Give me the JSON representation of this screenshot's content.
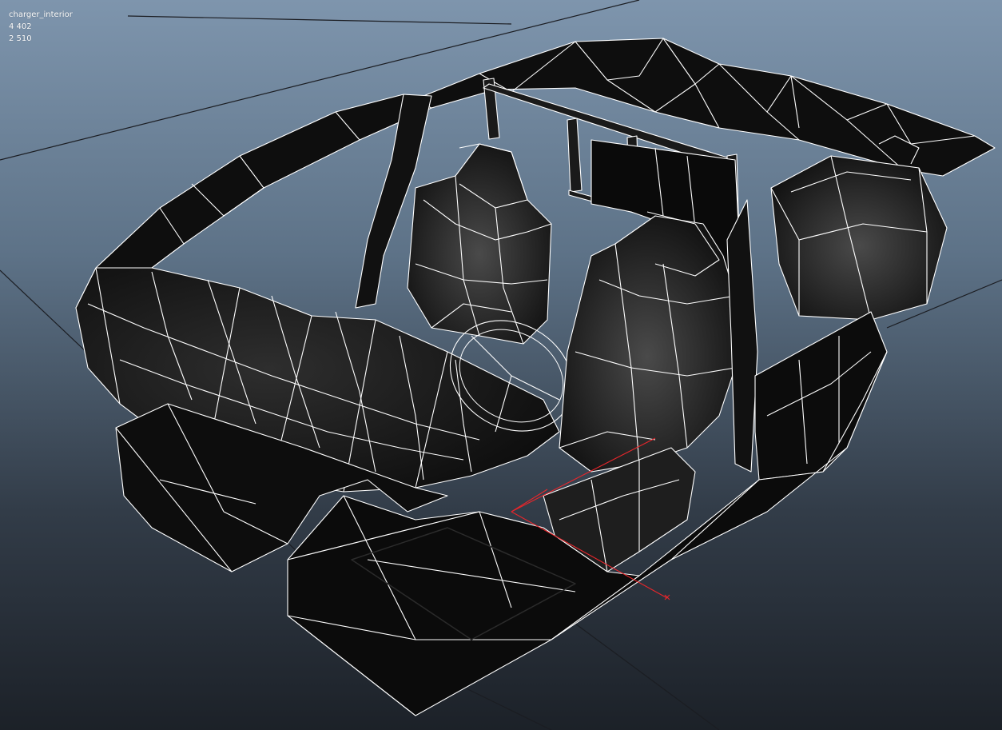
{
  "viewport": {
    "object_name": "charger_interior",
    "stats": [
      "4 402",
      "2 510"
    ],
    "display_mode": "wireframe-on-shaded",
    "colors": {
      "background_top": "#7e95ad",
      "background_bottom": "#1c2128",
      "grid": "#1b1d22",
      "wire": "#ffffff",
      "shade": "#0c0c0c",
      "shade_light": "#2c2c2c",
      "manipulator": "#e8262b"
    }
  }
}
